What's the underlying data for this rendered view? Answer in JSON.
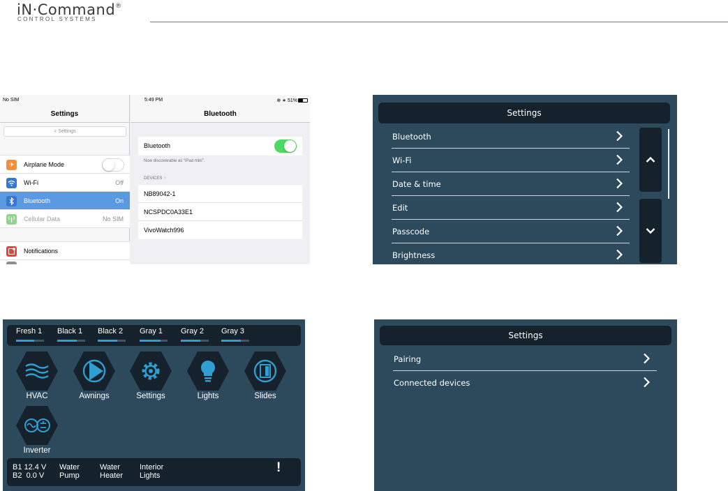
{
  "brand": {
    "name": "iN·Command",
    "reg": "®",
    "sub": "CONTROL SYSTEMS"
  },
  "ipad": {
    "status_left": "No SIM",
    "status_time": "5:49 PM",
    "status_right": "51%",
    "left_title": "Settings",
    "search_placeholder": "Settings",
    "rows": [
      {
        "label": "Airplane Mode",
        "value": "",
        "icon": "airplane-icon",
        "color": "#f0903a"
      },
      {
        "label": "Wi-Fi",
        "value": "Off",
        "icon": "wifi-icon",
        "color": "#3478d2"
      },
      {
        "label": "Bluetooth",
        "value": "On",
        "icon": "bluetooth-icon",
        "color": "#3478d2"
      },
      {
        "label": "Cellular Data",
        "value": "No SIM",
        "icon": "cellular-icon",
        "color": "#8fd48a"
      }
    ],
    "notifications": {
      "label": "Notifications",
      "icon": "notifications-icon",
      "color": "#e8413c"
    },
    "right_title": "Bluetooth",
    "bt_label": "Bluetooth",
    "discoverable": "Now discoverable as “iPad mini”.",
    "devices_header": "DEVICES",
    "devices": [
      "NB89042-1",
      "NCSPDC0A33E1",
      "VivoWatch996"
    ]
  },
  "panel_settings": {
    "title": "Settings",
    "items": [
      "Bluetooth",
      "Wi-Fi",
      "Date & time",
      "Edit",
      "Passcode",
      "Brightness"
    ]
  },
  "panel_home": {
    "tanks": [
      {
        "name": "Fresh 1",
        "level": 0.65
      },
      {
        "name": "Black 1",
        "level": 0.7
      },
      {
        "name": "Black 2",
        "level": 0.7
      },
      {
        "name": "Gray 1",
        "level": 0.75
      },
      {
        "name": "Gray 2",
        "level": 0.7
      },
      {
        "name": "Gray 3",
        "level": 0.7
      }
    ],
    "apps": [
      {
        "label": "HVAC",
        "icon": "hvac-icon"
      },
      {
        "label": "Awnings",
        "icon": "awnings-icon"
      },
      {
        "label": "Settings",
        "icon": "gear-icon"
      },
      {
        "label": "Lights",
        "icon": "lightbulb-icon"
      },
      {
        "label": "Slides",
        "icon": "slides-icon"
      },
      {
        "label": "Inverter",
        "icon": "inverter-icon"
      }
    ],
    "b1": "B1 12.4 V",
    "b2": "B2  0.0 V",
    "water_pump": [
      "Water",
      "Pump"
    ],
    "water_heater": [
      "Water",
      "Heater"
    ],
    "interior_lights": [
      "Interior",
      "Lights"
    ],
    "alert": "!"
  },
  "panel_bt": {
    "title": "Settings",
    "items": [
      "Pairing",
      "Connected devices"
    ]
  },
  "colors": {
    "panel_bg": "#2d4a5c",
    "titlebar_bg": "#15222c",
    "tank_fill": "#2e9fd0",
    "ios_selected": "#5a9ae0",
    "ios_toggle_on": "#4cd964",
    "battery_alert": "#f2673a"
  }
}
